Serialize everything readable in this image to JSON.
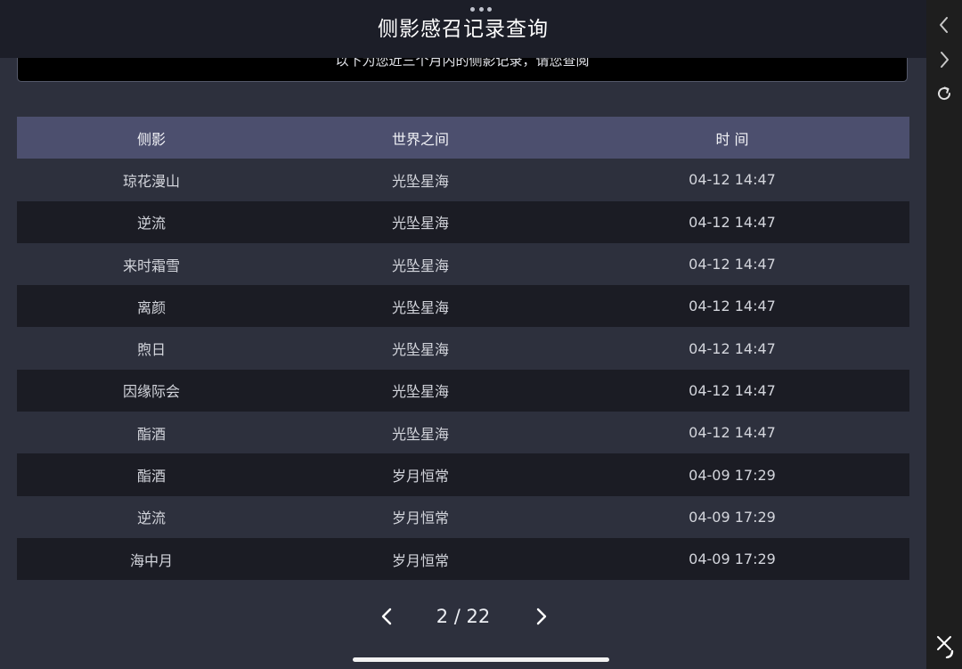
{
  "header": {
    "title": "侧影感召记录查询",
    "notice": "以下为您近三个月内的侧影记录，请您查阅"
  },
  "table": {
    "columns": [
      "侧影",
      "世界之间",
      "时 间"
    ],
    "rows": [
      {
        "shadow": "琼花漫山",
        "world": "光坠星海",
        "time": "04-12 14:47"
      },
      {
        "shadow": "逆流",
        "world": "光坠星海",
        "time": "04-12 14:47"
      },
      {
        "shadow": "来时霜雪",
        "world": "光坠星海",
        "time": "04-12 14:47"
      },
      {
        "shadow": "离颜",
        "world": "光坠星海",
        "time": "04-12 14:47"
      },
      {
        "shadow": "煦日",
        "world": "光坠星海",
        "time": "04-12 14:47"
      },
      {
        "shadow": "因缘际会",
        "world": "光坠星海",
        "time": "04-12 14:47"
      },
      {
        "shadow": "酯酒",
        "world": "光坠星海",
        "time": "04-12 14:47"
      },
      {
        "shadow": "酯酒",
        "world": "岁月恒常",
        "time": "04-09 17:29"
      },
      {
        "shadow": "逆流",
        "world": "岁月恒常",
        "time": "04-09 17:29"
      },
      {
        "shadow": "海中月",
        "world": "岁月恒常",
        "time": "04-09 17:29"
      }
    ]
  },
  "pagination": {
    "current": "2",
    "separator": "/",
    "total": "22",
    "prev_icon": "chevron-left-icon",
    "next_icon": "chevron-right-icon"
  },
  "side_toolbar": {
    "icons": [
      "chevron-left-icon",
      "chevron-right-icon",
      "refresh-icon",
      "close-icon"
    ]
  },
  "colors": {
    "background": "#2d303d",
    "header_bar": "#1c1e28",
    "table_header": "#4c4f6e",
    "row_alt": "#1b1c24",
    "side_toolbar": "#1e1e1e"
  }
}
